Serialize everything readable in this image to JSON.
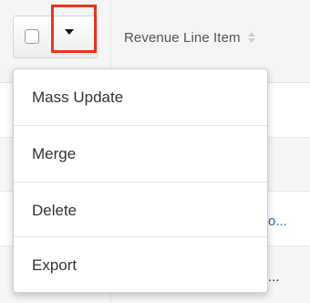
{
  "table": {
    "column_header": "Revenue Line Item",
    "row_cells": [
      "o...",
      "..."
    ]
  },
  "actions": {
    "menu_items": [
      "Mass Update",
      "Merge",
      "Delete",
      "Export"
    ]
  },
  "colors": {
    "highlight": "#e8361e",
    "link": "#1f6fb2"
  },
  "icons": {
    "checkbox": "checkbox-icon",
    "caret": "caret-down-icon",
    "sort": "sort-icon"
  }
}
